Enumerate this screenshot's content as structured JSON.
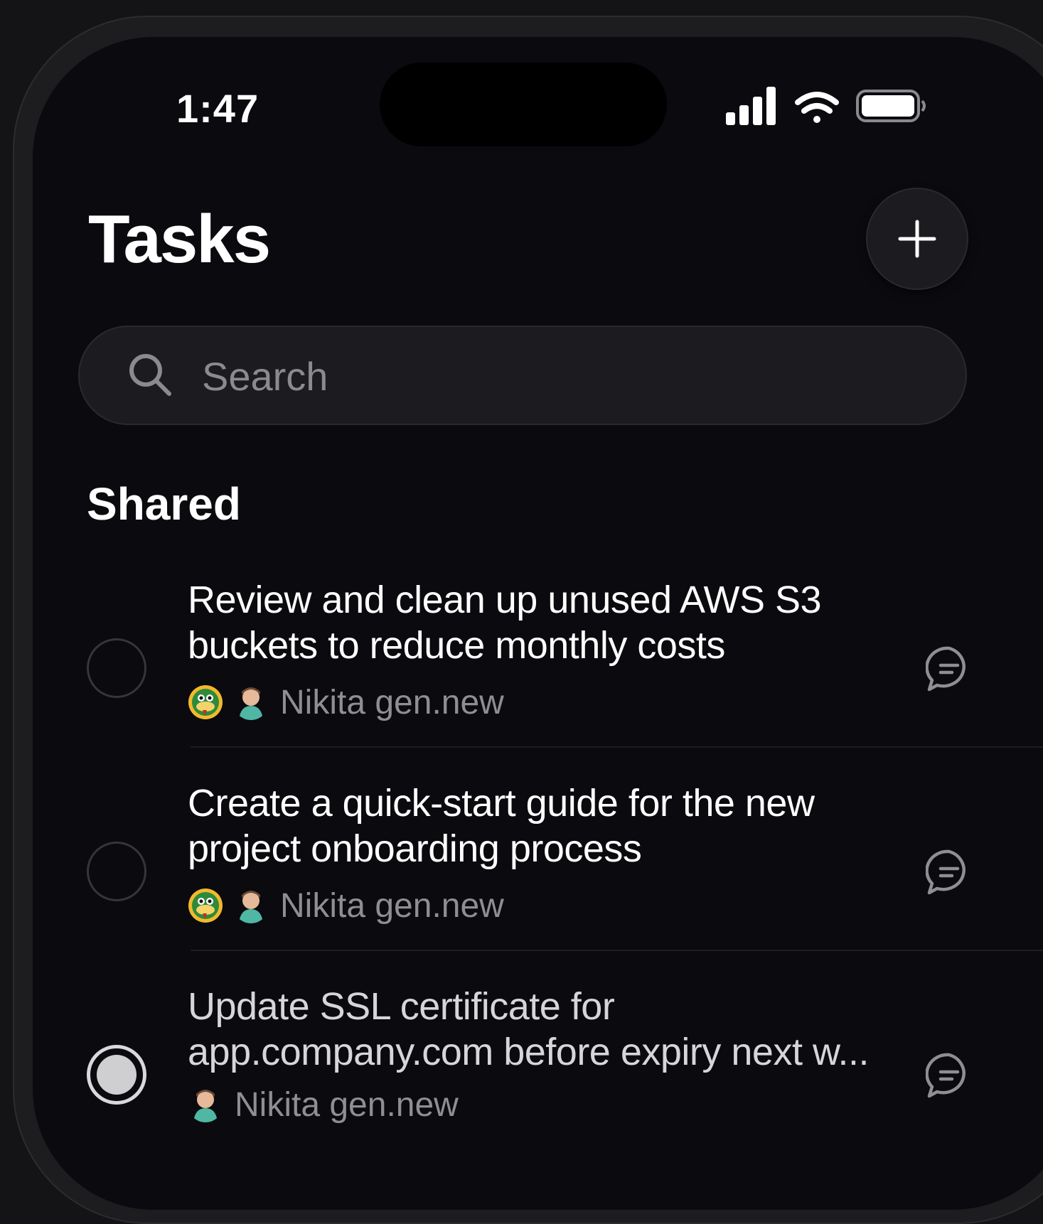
{
  "status_bar": {
    "time": "1:47"
  },
  "header": {
    "title": "Tasks",
    "add_icon": "plus-icon"
  },
  "search": {
    "placeholder": "Search",
    "icon": "search-icon"
  },
  "section": {
    "title": "Shared"
  },
  "tasks": [
    {
      "title_line1": "Review and clean up unused AWS S3",
      "title_line2": "buckets to reduce monthly costs",
      "assignees": "Nikita gen.new",
      "completed": false
    },
    {
      "title_line1": "Create a quick-start guide for the new",
      "title_line2": "project onboarding process",
      "assignees": "Nikita gen.new",
      "completed": false
    },
    {
      "title_line1": "Update SSL certificate for",
      "title_line2": "app.company.com before expiry next w...",
      "assignees": "Nikita gen.new",
      "completed": true
    }
  ],
  "colors": {
    "background": "#0b0a0e",
    "text": "#ffffff",
    "muted": "#8e8e93"
  }
}
